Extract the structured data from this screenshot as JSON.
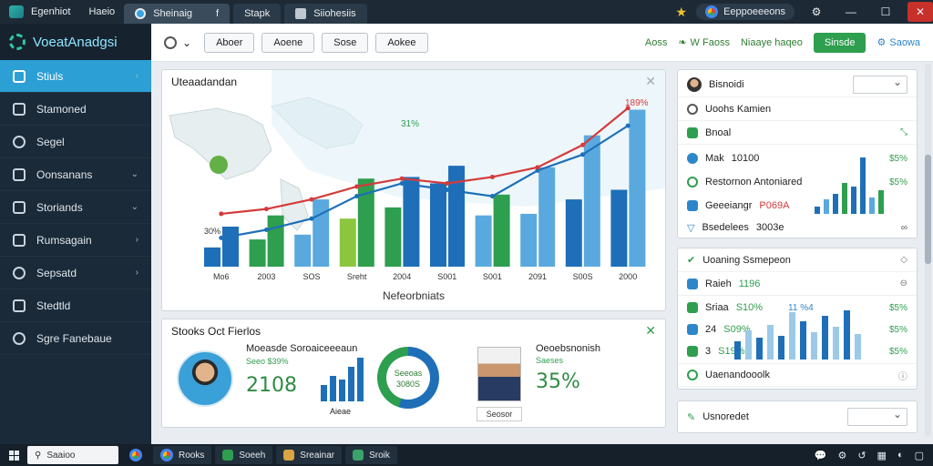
{
  "titlebar": {
    "app_name": "Egenhiot",
    "menu_item": "Haeio",
    "tabs": [
      {
        "label": "Sheinaig",
        "extra": "f"
      },
      {
        "label": "Stapk"
      },
      {
        "label": "Siiohesiis"
      }
    ],
    "profile_label": "Eeppoeeeons"
  },
  "sidebar": {
    "brand": "VoeatAnadgsi",
    "items": [
      {
        "label": "Stiuls",
        "active": true
      },
      {
        "label": "Stamoned"
      },
      {
        "label": "Segel"
      },
      {
        "label": "Oonsanans",
        "chevron": true
      },
      {
        "label": "Storiands",
        "chevron": true
      },
      {
        "label": "Rumsagain",
        "chevron": true
      },
      {
        "label": "Sepsatd",
        "chevron": true
      },
      {
        "label": "Stedtld"
      },
      {
        "label": "Sgre Fanebaue"
      }
    ]
  },
  "toolbar": {
    "buttons": [
      "Aboer",
      "Aoene",
      "Sose",
      "Aokee"
    ],
    "link1": "Aoss",
    "link2": "W Faoss",
    "link3": "Niaaye haqeo",
    "primary": "Sinsde",
    "gear_label": "Saowa"
  },
  "chart_panel": {
    "title": "Uteaadandan",
    "xlabel": "Nefeorbniats"
  },
  "chart_data": {
    "type": "bar",
    "categories": [
      "Mo6",
      "2003",
      "SOS",
      "Sreht",
      "2004",
      "S001",
      "S001",
      "2091",
      "S00S",
      "2000"
    ],
    "series": [
      {
        "values": [
          25,
          32,
          42,
          55,
          56,
          63,
          45,
          62,
          82,
          98
        ]
      },
      {
        "values": [
          12,
          17,
          20,
          30,
          37,
          52,
          32,
          33,
          42,
          48
        ]
      }
    ],
    "line_red": [
      33,
      36,
      42,
      50,
      55,
      52,
      56,
      62,
      76,
      99
    ],
    "line_blue": [
      18,
      23,
      30,
      44,
      52,
      48,
      44,
      60,
      70,
      88
    ],
    "annotations": {
      "top_right": "189%",
      "mid": "31%",
      "left": "30%"
    },
    "ylim": [
      0,
      100
    ]
  },
  "kpi_panel": {
    "title": "Stooks Oct Fierlos",
    "label1": "Moeasde Soroaiceeeaun",
    "sub1": "Seeo $39%",
    "big1": "2108",
    "bars_caption": "Aieae",
    "donut_top": "Seeoas",
    "donut_mid": "3080S",
    "label2": "Oeoebsnonish",
    "sub2": "Saeses",
    "big2": "35%",
    "photo_caption": "Seosor"
  },
  "right_panel_1": {
    "header": "Bisnoidi",
    "rows": [
      {
        "label": "Uoohs Kamien"
      },
      {
        "label": "Bnoal",
        "icon": "leaf-icon"
      },
      {
        "label": "Mak",
        "value": "10100",
        "pct": "$5%"
      },
      {
        "label": "Restornon Antoniared",
        "pct": "$5%"
      },
      {
        "label": "Geeeiangr",
        "value": "P069A",
        "pct": ""
      },
      {
        "label": "Bsedelees",
        "value": "3003e"
      }
    ]
  },
  "right_panel_2": {
    "header": "Uoaning Ssmepeon",
    "rows": [
      {
        "label": "Raieh",
        "value": "1196"
      },
      {
        "label": "Sriaa",
        "value": "S10%",
        "extra": "11 %4",
        "pct": "$5%"
      },
      {
        "label": "24",
        "value": "S09%",
        "pct": "$5%"
      },
      {
        "label": "3",
        "value": "S19%",
        "pct": "$5%"
      },
      {
        "label": "Uaenandooolk"
      }
    ]
  },
  "right_panel_3": {
    "header": "Usnoredet"
  },
  "taskbar": {
    "search": "Saaioo",
    "tasks": [
      "Rooks",
      "Soeeh",
      "Sreainar",
      "Sroik"
    ]
  }
}
